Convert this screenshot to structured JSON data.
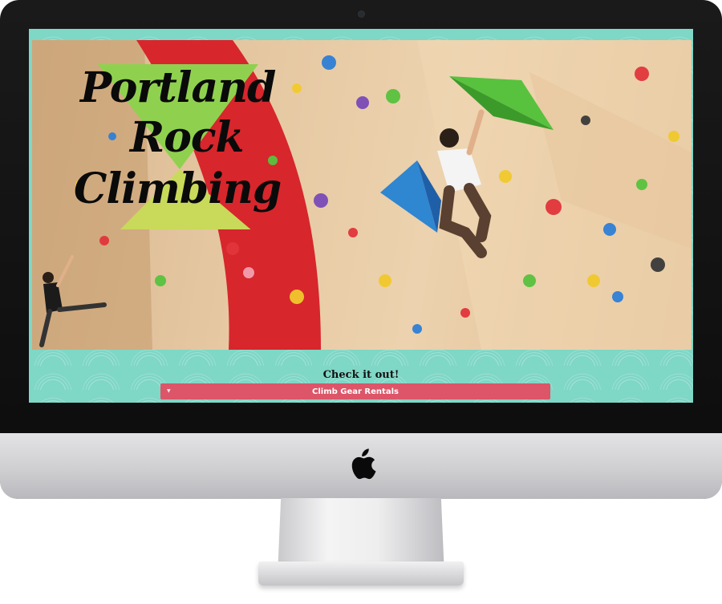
{
  "site": {
    "logo": {
      "line1": "Portland",
      "line2": "Rock",
      "line3": "Climbing"
    },
    "cta_label": "Check it out!",
    "cta_select": {
      "selected": "Climb Gear Rentals",
      "caret_icon": "chevron-down-icon"
    },
    "hero_image": "climbing-gym-wall-photo"
  },
  "device": {
    "brand_icon": "apple-logo-icon"
  },
  "colors": {
    "background_pattern": "#7fd7c6",
    "select_bg": "#dc5568",
    "logo_triangle_top": "#8fd14f",
    "logo_triangle_bottom": "#c9d95a",
    "wall_accent": "#d7262c"
  }
}
